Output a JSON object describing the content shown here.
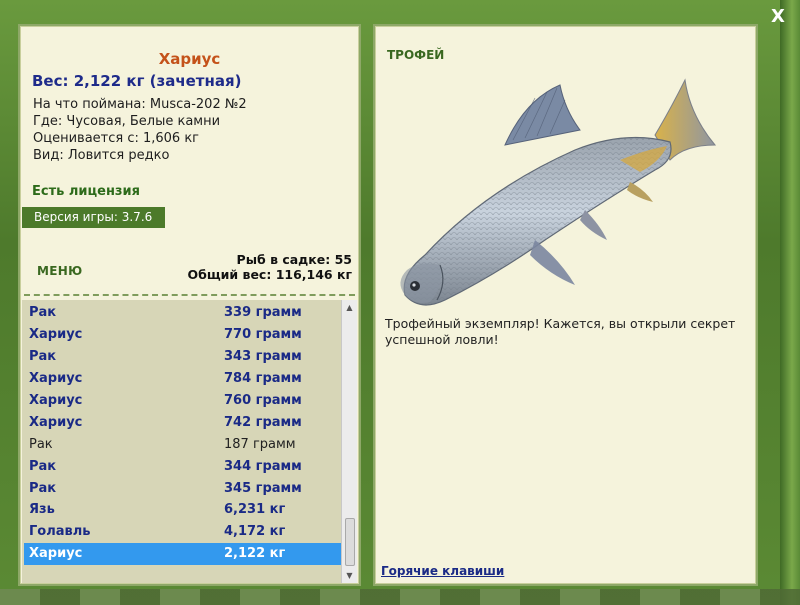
{
  "window": {
    "close_label": "X"
  },
  "catch": {
    "fish_name": "Хариус",
    "weight_line": "Вес: 2,122 кг (зачетная)",
    "info": [
      "На что поймана: Musca-202 №2",
      "Где: Чусовая, Белые камни",
      "Оценивается с: 1,606 кг",
      "Вид: Ловится редко"
    ],
    "license": "Есть лицензия",
    "version_label": "Версия игры:",
    "version_value": "3.7.6"
  },
  "menu_label": "МЕНЮ",
  "stats": {
    "fish_in_keepnet": "Рыб в садке: 55",
    "total_weight": "Общий вес: 116,146 кг"
  },
  "keepnet": [
    {
      "name": "Рак",
      "weight": "339 грамм",
      "style": "bold"
    },
    {
      "name": "Хариус",
      "weight": "770 грамм",
      "style": "bold"
    },
    {
      "name": "Рак",
      "weight": "343 грамм",
      "style": "bold"
    },
    {
      "name": "Хариус",
      "weight": "784 грамм",
      "style": "bold"
    },
    {
      "name": "Хариус",
      "weight": "760 грамм",
      "style": "bold"
    },
    {
      "name": "Хариус",
      "weight": "742 грамм",
      "style": "bold"
    },
    {
      "name": "Рак",
      "weight": "187 грамм",
      "style": "plain"
    },
    {
      "name": "Рак",
      "weight": "344 грамм",
      "style": "bold"
    },
    {
      "name": "Рак",
      "weight": "345 грамм",
      "style": "bold"
    },
    {
      "name": "Язь",
      "weight": "6,231 кг",
      "style": "bold"
    },
    {
      "name": "Голавль",
      "weight": "4,172 кг",
      "style": "bold"
    },
    {
      "name": "Хариус",
      "weight": "2,122 кг",
      "style": "selected"
    }
  ],
  "trophy": {
    "label": "ТРОФЕЙ",
    "message": "Трофейный экземпляр! Кажется, вы открыли секрет успешной ловли!",
    "hotkeys": "Горячие клавиши"
  },
  "colors": {
    "accent_green": "#4c7a2a",
    "fish_name": "#c4521a",
    "text_blue": "#1a2a86",
    "selection": "#3399ee",
    "panel_bg": "#f5f3dc"
  }
}
